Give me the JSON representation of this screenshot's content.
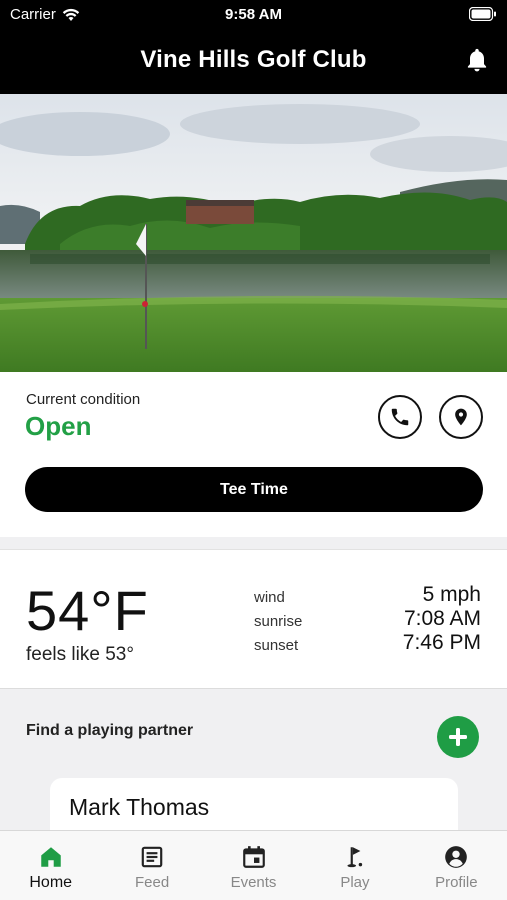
{
  "status_bar": {
    "carrier": "Carrier",
    "time": "9:58 AM"
  },
  "header": {
    "title": "Vine Hills Golf Club"
  },
  "condition": {
    "label": "Current condition",
    "value": "Open",
    "value_color": "#22a046",
    "tee_time_label": "Tee Time"
  },
  "weather": {
    "temperature": "54°F",
    "feels_like": "feels like 53°",
    "wind_label": "wind",
    "wind_value": "5 mph",
    "sunrise_label": "sunrise",
    "sunrise_value": "7:08 AM",
    "sunset_label": "sunset",
    "sunset_value": "7:46 PM"
  },
  "partner": {
    "title": "Find a playing partner",
    "cards": [
      {
        "name": "Mark Thomas"
      }
    ]
  },
  "tabs": [
    {
      "label": "Home",
      "icon": "home-icon",
      "active": true
    },
    {
      "label": "Feed",
      "icon": "feed-icon",
      "active": false
    },
    {
      "label": "Events",
      "icon": "calendar-icon",
      "active": false
    },
    {
      "label": "Play",
      "icon": "golf-flag-icon",
      "active": false
    },
    {
      "label": "Profile",
      "icon": "profile-icon",
      "active": false
    }
  ],
  "colors": {
    "accent_green": "#1f9d45",
    "header_bg": "#000000"
  }
}
